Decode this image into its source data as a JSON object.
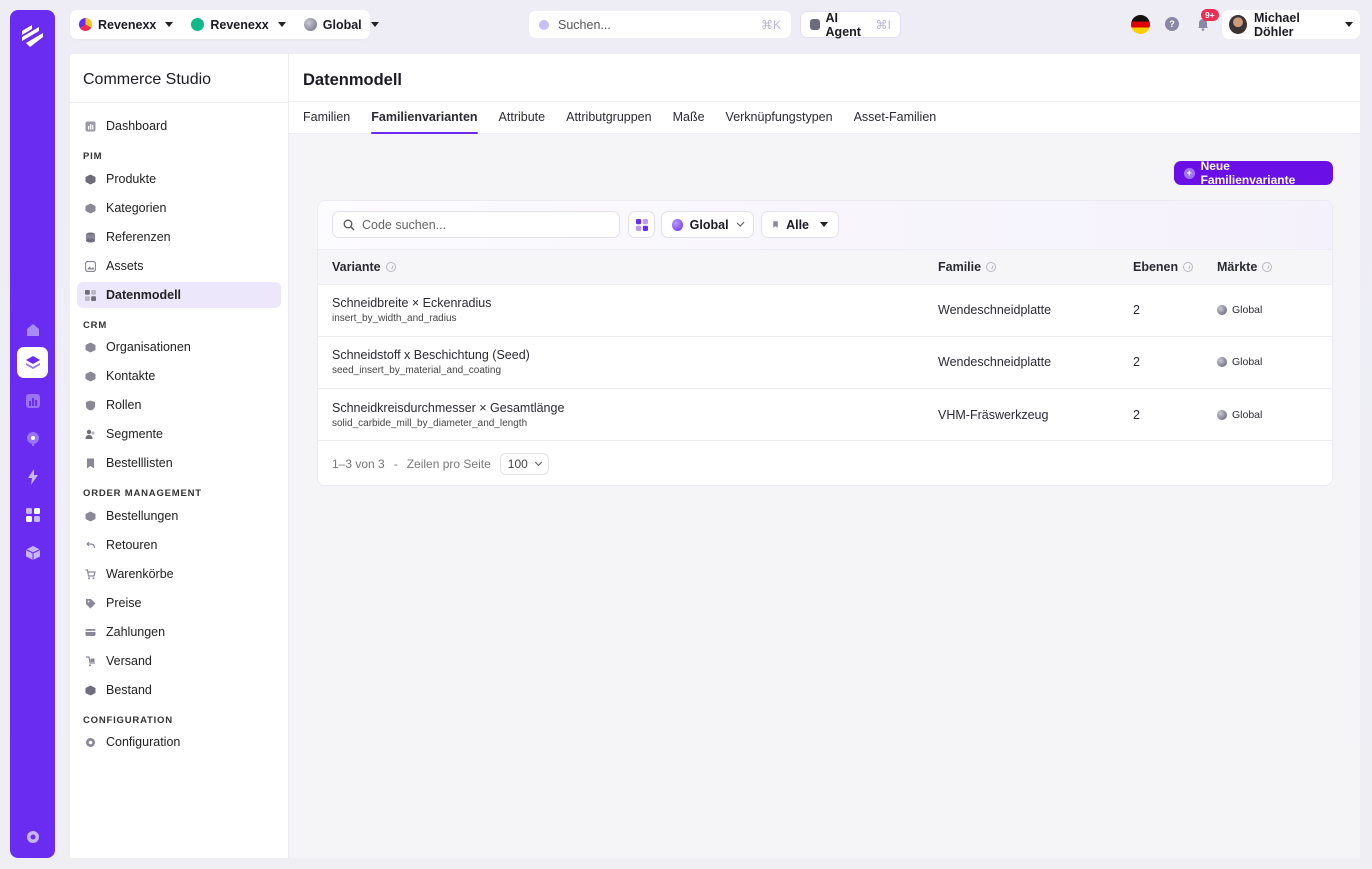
{
  "topbar": {
    "org1": "Revenexx",
    "org2": "Revenexx",
    "scope": "Global",
    "search_placeholder": "Suchen...",
    "search_shortcut": "⌘K",
    "ai_agent_label": "AI Agent",
    "ai_agent_shortcut": "⌘I",
    "notifications_badge": "9+",
    "user_name": "Michael Döhler"
  },
  "sidenav": {
    "title": "Commerce Studio",
    "dashboard": "Dashboard",
    "sections": {
      "pim": "PIM",
      "crm": "CRM",
      "order": "ORDER MANAGEMENT",
      "config": "CONFIGURATION"
    },
    "pim_items": [
      "Produkte",
      "Kategorien",
      "Referenzen",
      "Assets",
      "Datenmodell"
    ],
    "crm_items": [
      "Organisationen",
      "Kontakte",
      "Rollen",
      "Segmente",
      "Bestelllisten"
    ],
    "order_items": [
      "Bestellungen",
      "Retouren",
      "Warenkörbe",
      "Preise",
      "Zahlungen",
      "Versand",
      "Bestand"
    ],
    "config_items": [
      "Configuration"
    ]
  },
  "main": {
    "title": "Datenmodell",
    "tabs": [
      "Familien",
      "Familienvarianten",
      "Attribute",
      "Attributgruppen",
      "Maße",
      "Verknüpfungstypen",
      "Asset-Familien"
    ],
    "new_button": "Neue Familienvariante",
    "filters": {
      "search_placeholder": "Code suchen...",
      "scope": "Global",
      "status": "Alle"
    },
    "table": {
      "columns": [
        "Variante",
        "Familie",
        "Ebenen",
        "Märkte"
      ],
      "rows": [
        {
          "name": "Schneidbreite × Eckenradius",
          "code": "insert_by_width_and_radius",
          "family": "Wendeschneidplatte",
          "levels": "2",
          "market": "Global"
        },
        {
          "name": "Schneidstoff x Beschichtung (Seed)",
          "code": "seed_insert_by_material_and_coating",
          "family": "Wendeschneidplatte",
          "levels": "2",
          "market": "Global"
        },
        {
          "name": "Schneidkreisdurchmesser × Gesamtlänge",
          "code": "solid_carbide_mill_by_diameter_and_length",
          "family": "VHM-Fräswerkzeug",
          "levels": "2",
          "market": "Global"
        }
      ]
    },
    "pagination": {
      "range": "1–3 von 3",
      "separator": "-",
      "rows_label": "Zeilen pro Seite",
      "rows_value": "100"
    }
  },
  "colors": {
    "brand": "#6a2cf0",
    "button": "#6a10e6",
    "active_nav": "#ece7fb"
  }
}
